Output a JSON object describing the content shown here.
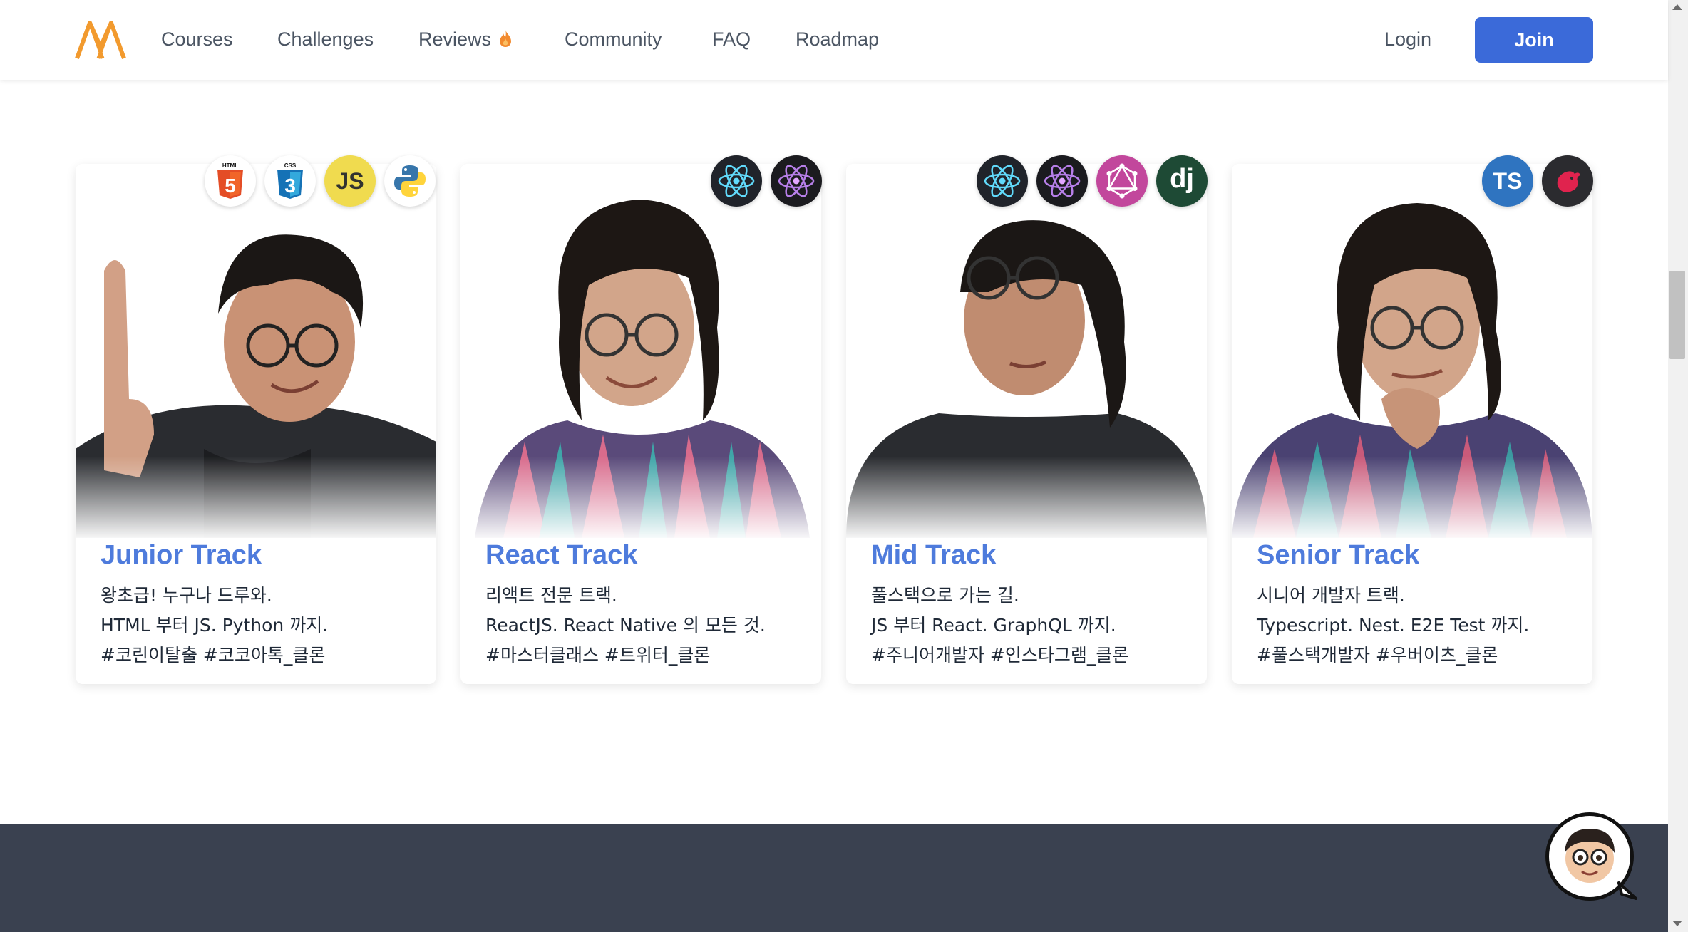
{
  "nav": {
    "links": [
      "Courses",
      "Challenges",
      "Reviews",
      "Community",
      "FAQ",
      "Roadmap"
    ],
    "login": "Login",
    "join": "Join"
  },
  "tracks": [
    {
      "title": "Junior Track",
      "lines": [
        "왕초급! 누구나 드루와.",
        "HTML 부터 JS. Python 까지.",
        "#코린이탈출 #코코아톡_클론"
      ],
      "badges": [
        "html5-icon",
        "css3-icon",
        "javascript-icon",
        "python-icon"
      ]
    },
    {
      "title": "React Track",
      "lines": [
        "리액트 전문 트랙.",
        "ReactJS. React Native 의 모든 것.",
        "#마스터클래스 #트위터_클론"
      ],
      "badges": [
        "react-icon",
        "react-native-icon"
      ]
    },
    {
      "title": "Mid Track",
      "lines": [
        "풀스택으로 가는 길.",
        "JS 부터 React. GraphQL 까지.",
        "#주니어개발자 #인스타그램_클론"
      ],
      "badges": [
        "react-icon",
        "react-native-icon",
        "graphql-icon",
        "django-icon"
      ]
    },
    {
      "title": "Senior Track",
      "lines": [
        "시니어 개발자 트랙.",
        "Typescript. Nest. E2E Test 까지.",
        "#풀스택개발자 #우버이츠_클론"
      ],
      "badges": [
        "typescript-icon",
        "nestjs-icon"
      ]
    }
  ],
  "badge_text": {
    "js": "JS",
    "ts": "TS",
    "dj": "dj",
    "html": "HTML",
    "css": "CSS"
  },
  "colors": {
    "accent": "#3b6ad9",
    "title": "#4e7bdc",
    "logo": "#f29a2e",
    "footer": "#3a4150"
  }
}
